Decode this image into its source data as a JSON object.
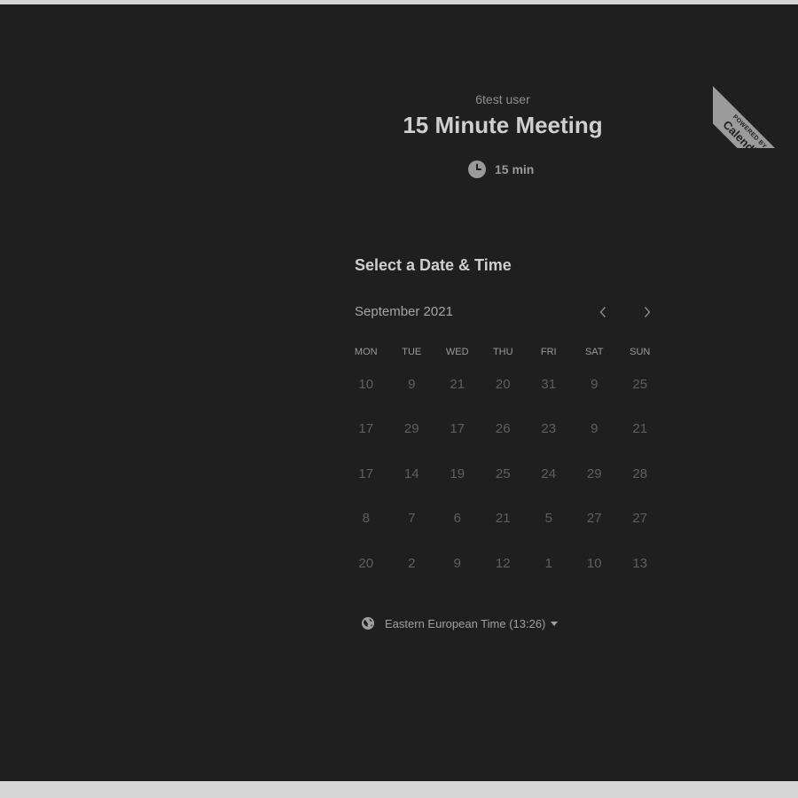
{
  "badge": {
    "powered_by": "POWERED BY",
    "brand": "Calendly"
  },
  "event": {
    "owner": "6test user",
    "title": "15 Minute Meeting",
    "duration": "15 min"
  },
  "calendar": {
    "heading": "Select a Date & Time",
    "month_label": "September 2021",
    "weekdays": [
      "MON",
      "TUE",
      "WED",
      "THU",
      "FRI",
      "SAT",
      "SUN"
    ],
    "weeks": [
      [
        "10",
        "9",
        "21",
        "20",
        "31",
        "9",
        "25"
      ],
      [
        "17",
        "29",
        "17",
        "26",
        "23",
        "9",
        "21"
      ],
      [
        "17",
        "14",
        "19",
        "25",
        "24",
        "29",
        "28"
      ],
      [
        "8",
        "7",
        "6",
        "21",
        "5",
        "27",
        "27"
      ],
      [
        "20",
        "2",
        "9",
        "12",
        "1",
        "10",
        "13"
      ]
    ]
  },
  "timezone": {
    "label": "Eastern European Time (13:26)"
  },
  "icons": {
    "clock": "clock-icon",
    "prev": "chevron-left-icon",
    "next": "chevron-right-icon",
    "globe": "globe-icon",
    "caret": "caret-down-icon"
  },
  "colors": {
    "background": "#1f1f1f",
    "outer": "#d6d6d6",
    "badge": "#9b9b9b"
  }
}
